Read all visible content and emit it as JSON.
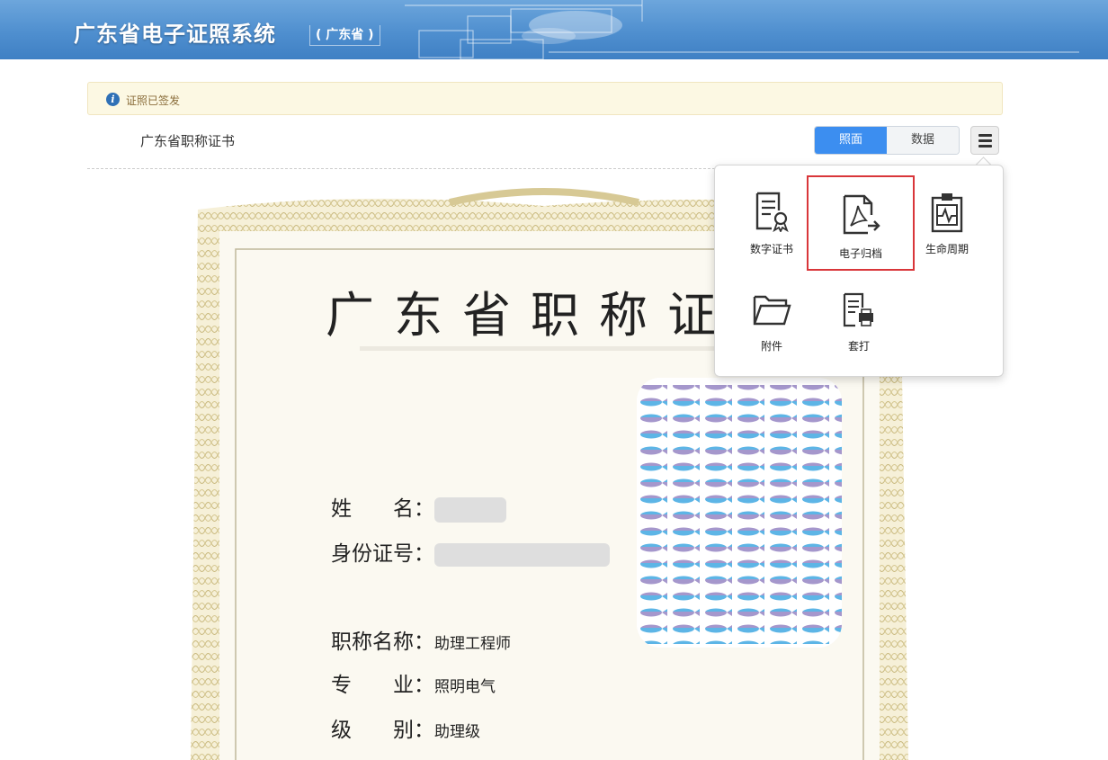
{
  "header": {
    "title": "广东省电子证照系统",
    "subtitle": "( 广东省 )"
  },
  "status": {
    "icon": "info-icon",
    "text": "证照已签发"
  },
  "certificate_title": "广东省职称证书",
  "view_toggle": {
    "options": [
      "照面",
      "数据"
    ],
    "selected": "照面",
    "active_color": "#3c8ef0"
  },
  "menu_button": {
    "icon": "hamburger-icon"
  },
  "dropdown_menu": {
    "items": [
      {
        "label": "数字证书",
        "icon": "certificate-icon"
      },
      {
        "label": "电子归档",
        "icon": "pdf-archive-icon",
        "highlighted": true
      },
      {
        "label": "生命周期",
        "icon": "clipboard-pulse-icon"
      },
      {
        "label": "附件",
        "icon": "folder-icon"
      },
      {
        "label": "套打",
        "icon": "print-document-icon"
      }
    ],
    "highlight_color": "#d9363a"
  },
  "certificate_document": {
    "heading": "广东省职称证",
    "fields": [
      {
        "label": "姓　　名：",
        "value": ""
      },
      {
        "label": "身份证号：",
        "value": ""
      },
      {
        "label": "职称名称：",
        "value": "助理工程师"
      },
      {
        "label": "专　　业：",
        "value": "照明电气"
      },
      {
        "label": "级　　别：",
        "value": "助理级"
      }
    ]
  }
}
